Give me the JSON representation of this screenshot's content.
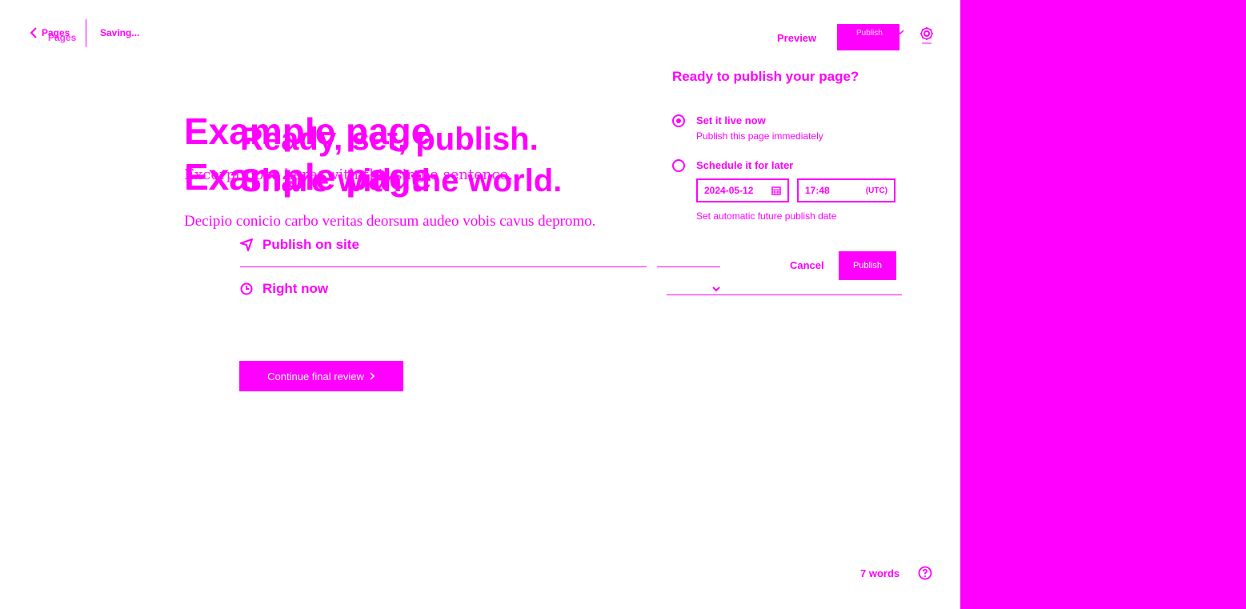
{
  "header": {
    "back_label": "Pages",
    "back_label_ghost": "Pages",
    "saving_status": "Saving...",
    "preview_label": "Preview",
    "publish_label": "Publish"
  },
  "editor": {
    "title": "Example page",
    "title_ghost": "Example page",
    "excerpt": "Excerpt goes here, with this single sentence.",
    "body": "Decipio conicio carbo veritas deorsum audeo vobis cavus depromo."
  },
  "modal": {
    "heading_line1": "Ready, set, publish.",
    "heading_line2": "Share with the world.",
    "rows": [
      {
        "label": "Publish on site",
        "icon": "send-icon"
      },
      {
        "label": "Right now",
        "icon": "clock-icon"
      }
    ],
    "continue_label": "Continue final review"
  },
  "popover": {
    "title": "Ready to publish your page?",
    "options": [
      {
        "title": "Set it live now",
        "subtitle": "Publish this page immediately",
        "selected": true
      },
      {
        "title": "Schedule it for later",
        "subtitle": "",
        "selected": false
      }
    ],
    "date_value": "2024-05-12",
    "time_value": "17:48",
    "timezone": "(UTC)",
    "schedule_hint": "Set automatic future publish date",
    "cancel_label": "Cancel",
    "publish_label": "Publish"
  },
  "footer": {
    "word_count": "7 words"
  },
  "colors": {
    "accent": "#ff00ff",
    "background": "#ffffff"
  }
}
